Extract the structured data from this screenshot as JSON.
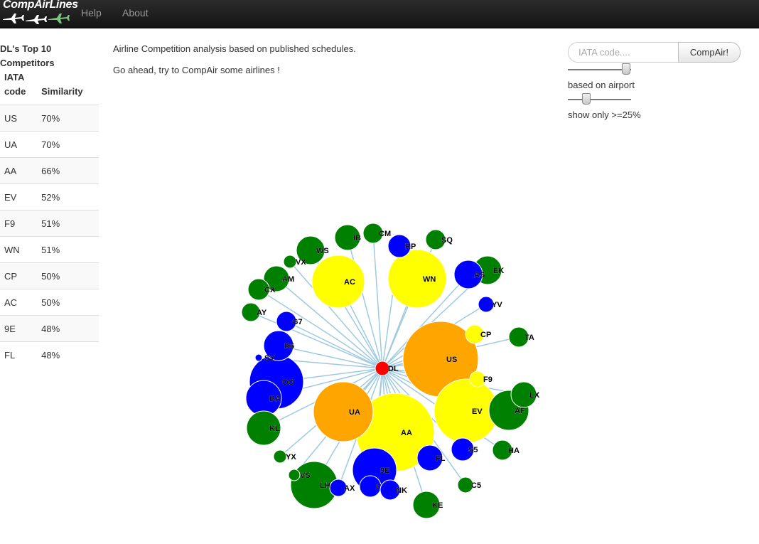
{
  "nav": {
    "brand": "CompAirLines",
    "help": "Help",
    "about": "About"
  },
  "sidebar": {
    "title_line1": "DL's Top 10",
    "title_line2": "Competitors",
    "col_code_line1": "IATA",
    "col_code_line2": "code",
    "col_similarity": "Similarity",
    "rows": [
      {
        "code": "US",
        "similarity": "70%"
      },
      {
        "code": "UA",
        "similarity": "70%"
      },
      {
        "code": "AA",
        "similarity": "66%"
      },
      {
        "code": "EV",
        "similarity": "52%"
      },
      {
        "code": "F9",
        "similarity": "51%"
      },
      {
        "code": "WN",
        "similarity": "51%"
      },
      {
        "code": "CP",
        "similarity": "50%"
      },
      {
        "code": "AC",
        "similarity": "50%"
      },
      {
        "code": "9E",
        "similarity": "48%"
      },
      {
        "code": "FL",
        "similarity": "48%"
      }
    ]
  },
  "intro": {
    "line1": "Airline Competition analysis based on published schedules.",
    "line2": "Go ahead, try to CompAir some airlines !"
  },
  "form": {
    "placeholder": "IATA code....",
    "button": "CompAir!",
    "slider1_label": "based on airport",
    "slider1_value": 0.95,
    "slider2_label": "show only >=25%",
    "slider2_value": 0.25
  },
  "colors": {
    "center": "#ff0000",
    "orange": "#ffa500",
    "yellow": "#ffff00",
    "green": "#008000",
    "blue": "#0000ff",
    "link": "#9ecae1"
  },
  "graph": {
    "center": "DL",
    "nodes": [
      {
        "code": "US",
        "color": "orange"
      },
      {
        "code": "UA",
        "color": "orange"
      },
      {
        "code": "AA",
        "color": "yellow"
      },
      {
        "code": "EV",
        "color": "yellow"
      },
      {
        "code": "WN",
        "color": "yellow"
      },
      {
        "code": "AC",
        "color": "yellow"
      },
      {
        "code": "CP",
        "color": "yellow"
      },
      {
        "code": "F9",
        "color": "yellow"
      },
      {
        "code": "IB",
        "color": "green"
      },
      {
        "code": "CM",
        "color": "green"
      },
      {
        "code": "SQ",
        "color": "green"
      },
      {
        "code": "WS",
        "color": "green"
      },
      {
        "code": "VX",
        "color": "green"
      },
      {
        "code": "AM",
        "color": "green"
      },
      {
        "code": "CX",
        "color": "green"
      },
      {
        "code": "AY",
        "color": "green"
      },
      {
        "code": "EK",
        "color": "green"
      },
      {
        "code": "TA",
        "color": "green"
      },
      {
        "code": "LX",
        "color": "green"
      },
      {
        "code": "AF",
        "color": "green"
      },
      {
        "code": "HA",
        "color": "green"
      },
      {
        "code": "C5",
        "color": "green"
      },
      {
        "code": "KE",
        "color": "green"
      },
      {
        "code": "KL",
        "color": "green"
      },
      {
        "code": "YX",
        "color": "green"
      },
      {
        "code": "VS",
        "color": "green"
      },
      {
        "code": "LH",
        "color": "green"
      },
      {
        "code": "RP",
        "color": "blue"
      },
      {
        "code": "AS",
        "color": "blue"
      },
      {
        "code": "YV",
        "color": "blue"
      },
      {
        "code": "G7",
        "color": "blue"
      },
      {
        "code": "B6",
        "color": "blue"
      },
      {
        "code": "SY",
        "color": "blue"
      },
      {
        "code": "OO",
        "color": "blue"
      },
      {
        "code": "BA",
        "color": "blue"
      },
      {
        "code": "S5",
        "color": "blue"
      },
      {
        "code": "FL",
        "color": "blue"
      },
      {
        "code": "9E",
        "color": "blue"
      },
      {
        "code": "OH",
        "color": "blue"
      },
      {
        "code": "NK",
        "color": "blue"
      },
      {
        "code": "AX",
        "color": "blue"
      }
    ]
  }
}
